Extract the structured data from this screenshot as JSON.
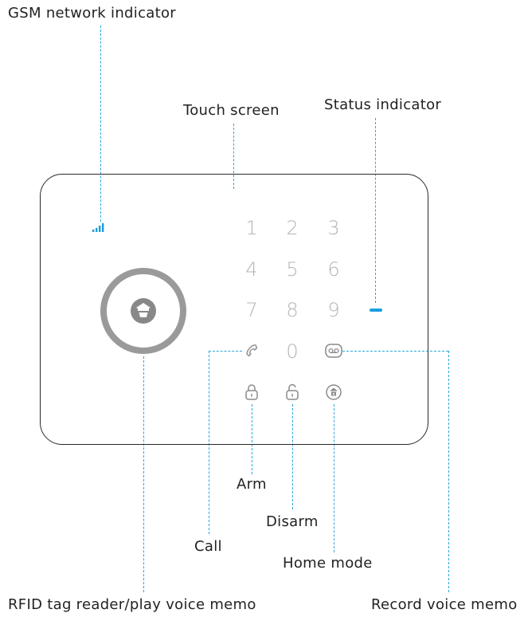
{
  "labels": {
    "gsm": "GSM network indicator",
    "touch": "Touch screen",
    "status": "Status indicator",
    "arm": "Arm",
    "disarm": "Disarm",
    "call": "Call",
    "home": "Home mode",
    "rfid": "RFID tag reader/play voice memo",
    "record": "Record voice memo"
  },
  "keypad": [
    "1",
    "2",
    "3",
    "4",
    "5",
    "6",
    "7",
    "8",
    "9",
    "0"
  ],
  "colors": {
    "guide": "#29a8d9",
    "status_led": "#1a9ee0",
    "key_text": "#b5b5b5",
    "ring": "#9a9a9a",
    "outline": "#2a2a2a"
  },
  "icons": [
    "signal-icon",
    "home-shield-icon",
    "phone-icon",
    "voicemail-icon",
    "lock-icon",
    "unlock-icon",
    "home-lock-icon"
  ]
}
